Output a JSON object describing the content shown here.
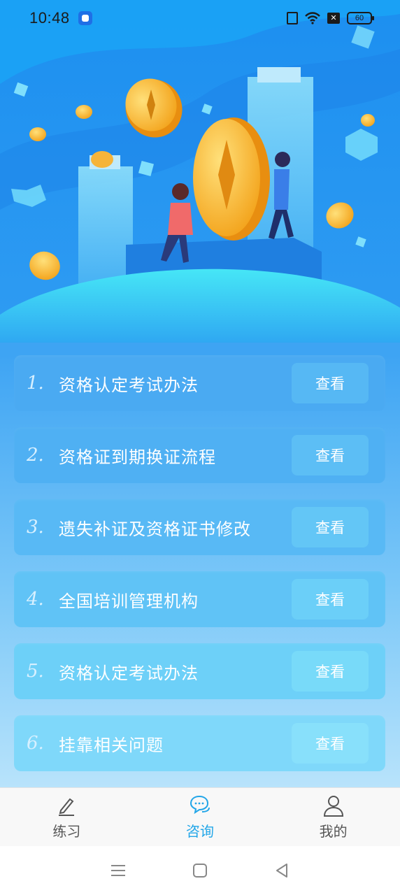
{
  "status_bar": {
    "time": "10:48",
    "battery": "60"
  },
  "list": {
    "items": [
      {
        "num": "1.",
        "title": "资格认定考试办法",
        "button": "查看",
        "bg": "#4aaaf2",
        "btn_bg": "#56b8f4"
      },
      {
        "num": "2.",
        "title": "资格证到期换证流程",
        "button": "查看",
        "bg": "#4fb0f3",
        "btn_bg": "#5cbef5"
      },
      {
        "num": "3.",
        "title": "遗失补证及资格证书修改",
        "button": "查看",
        "bg": "#58b9f5",
        "btn_bg": "#63c6f6"
      },
      {
        "num": "4.",
        "title": "全国培训管理机构",
        "button": "查看",
        "bg": "#60c3f6",
        "btn_bg": "#6bcff8"
      },
      {
        "num": "5.",
        "title": "资格认定考试办法",
        "button": "查看",
        "bg": "#6dd0f8",
        "btn_bg": "#78daf9"
      },
      {
        "num": "6.",
        "title": "挂靠相关问题",
        "button": "查看",
        "bg": "#7fd8fa",
        "btn_bg": "#88e0fb"
      }
    ]
  },
  "tabbar": {
    "tabs": [
      {
        "label": "练习",
        "icon": "pencil-icon"
      },
      {
        "label": "咨询",
        "icon": "chat-bubbles-icon"
      },
      {
        "label": "我的",
        "icon": "person-icon"
      }
    ],
    "active_color": "#22a6e8"
  }
}
